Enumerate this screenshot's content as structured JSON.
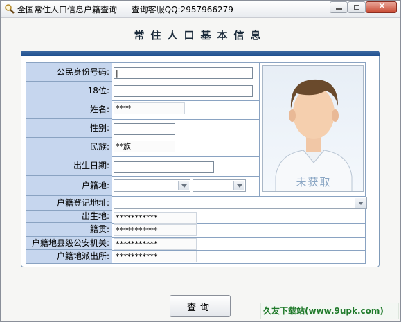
{
  "window": {
    "title": "全国常住人口信息户籍查询 --- 查询客服QQ:2957966279"
  },
  "form": {
    "heading": "常住人口基本信息",
    "id_label": "公民身份号码:",
    "id_value": "|",
    "digits_label": "18位:",
    "name_label": "姓名:",
    "name_value": "****",
    "gender_label": "性别:",
    "ethnicity_label": "民族:",
    "ethnicity_value": "**族",
    "birthdate_label": "出生日期:",
    "hukou_place_label": "户籍地:",
    "registered_address_label": "户籍登记地址:",
    "birthplace_label": "出生地:",
    "birthplace_value": "***********",
    "native_place_label": "籍贯:",
    "native_place_value": "***********",
    "police_bureau_label": "户籍地县级公安机关:",
    "police_bureau_value": "***********",
    "police_station_label": "户籍地派出所:",
    "police_station_value": "***********"
  },
  "photo": {
    "caption": "未获取"
  },
  "actions": {
    "query_label": "查询"
  },
  "watermark": {
    "text": "久友下载站(www.9upk.com)"
  }
}
